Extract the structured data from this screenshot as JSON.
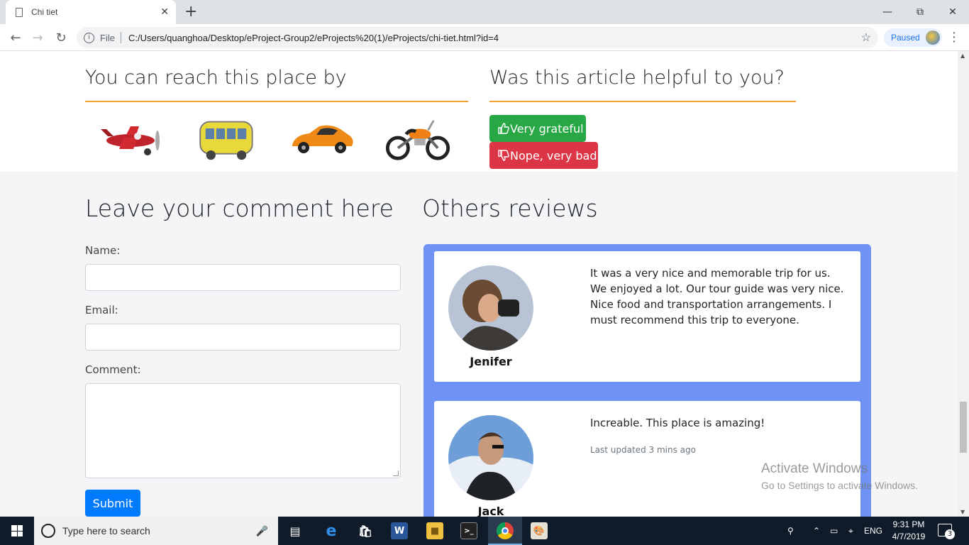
{
  "browser": {
    "tab_title": "Chi tiet",
    "tab_close": "✕",
    "new_tab": "+",
    "scheme": "File",
    "url": "C:/Users/quanghoa/Desktop/eProject-Group2/eProjects%20(1)/eProjects/chi-tiet.html?id=4",
    "profile_status": "Paused"
  },
  "reach": {
    "heading": "You can reach this place by",
    "vehicles": [
      "plane-icon",
      "bus-icon",
      "car-icon",
      "motorbike-icon"
    ]
  },
  "helpful": {
    "heading": "Was this article helpful to you?",
    "yes_label": "Very grateful",
    "no_label": "Nope, very bad"
  },
  "comment_form": {
    "heading": "Leave your comment here",
    "name_label": "Name:",
    "email_label": "Email:",
    "comment_label": "Comment:",
    "submit_label": "Submit"
  },
  "reviews": {
    "heading": "Others reviews",
    "items": [
      {
        "name": "Jenifer",
        "text": "It was a very nice and memorable trip for us. We enjoyed a lot. Our tour guide was very nice. Nice food and transportation arrangements. I must recommend this trip to everyone.",
        "meta": ""
      },
      {
        "name": "Jack",
        "text": "Increable. This place is amazing!",
        "meta": "Last updated 3 mins ago"
      }
    ]
  },
  "watermark": {
    "title": "Activate Windows",
    "subtitle": "Go to Settings to activate Windows."
  },
  "taskbar": {
    "search_placeholder": "Type here to search",
    "language": "ENG",
    "time": "9:31 PM",
    "date": "4/7/2019",
    "notification_count": "3"
  },
  "colors": {
    "accent_orange": "#f2a12c",
    "success": "#28a745",
    "danger": "#dc3545",
    "primary": "#007bff",
    "reviews_panel": "#6f93f5"
  }
}
